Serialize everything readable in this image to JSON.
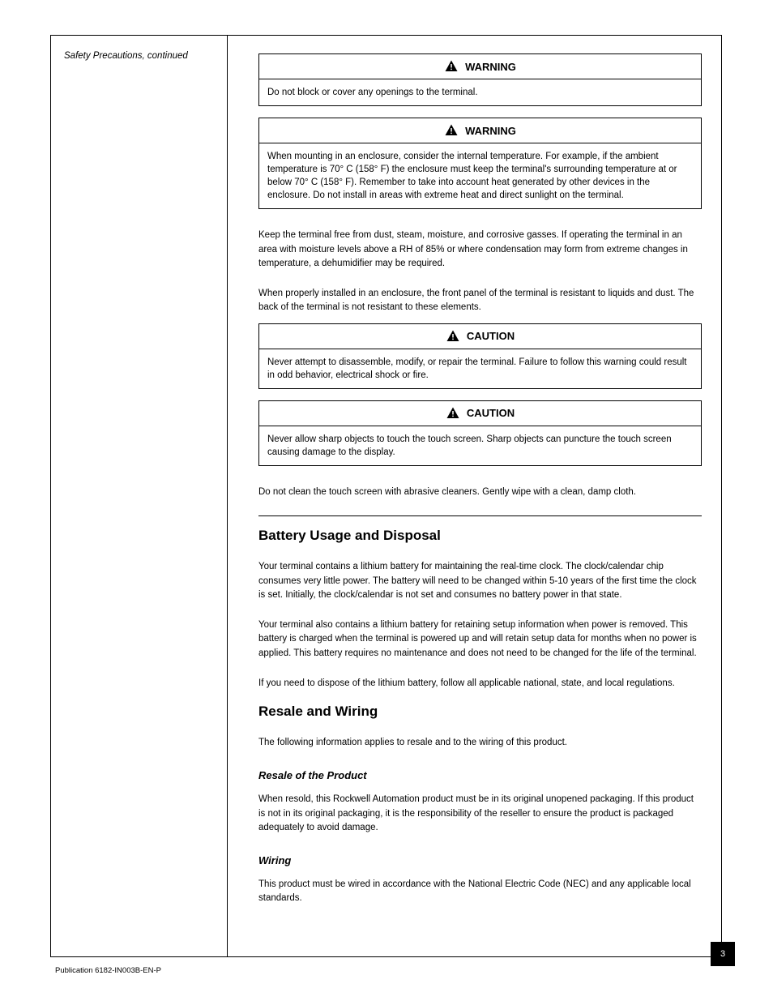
{
  "sidebar": {
    "kicker": "Safety Precautions, continued"
  },
  "callouts": [
    {
      "label": "WARNING",
      "body": "Do not block or cover any openings to the terminal."
    },
    {
      "label": "WARNING",
      "body": "When mounting in an enclosure, consider the internal temperature. For example, if the ambient temperature is 70° C (158° F) the enclosure must keep the terminal's surrounding temperature at or below 70° C  (158° F). Remember to take into account heat generated by other devices in the enclosure. Do not install in areas with extreme heat and direct sunlight on the terminal."
    },
    {
      "label": "CAUTION",
      "body": "Never attempt to disassemble, modify, or repair the terminal. Failure to follow this warning could result in odd behavior, electrical shock or fire."
    },
    {
      "label": "CAUTION",
      "body": "Never allow sharp objects to touch the touch screen. Sharp objects can puncture the touch screen causing damage to the display."
    }
  ],
  "paras": {
    "p1": "Keep the terminal free from dust, steam, moisture, and corrosive gasses. If operating the terminal in an area with moisture levels above a RH of 85% or where condensation may form from extreme changes in temperature, a dehumidifier may be required.",
    "p2": "When properly installed in an enclosure, the front panel of the terminal is resistant to liquids and dust. The back of the terminal is not resistant to these elements.",
    "p3": "Do not clean the touch screen with abrasive cleaners.  Gently wipe with a clean, damp cloth.",
    "p4": "Your terminal contains a lithium battery for maintaining the real-time clock. The clock/calendar chip consumes very little power. The battery will need to be changed within 5-10 years of the first time the clock is set. Initially, the clock/calendar is not set and consumes no battery power in that state.",
    "p5": "Your terminal also contains a lithium battery for retaining setup information when power is removed. This battery is charged when the terminal is powered up and will retain setup data for months when no power is applied. This battery requires no maintenance and does not need to be changed for the life of the terminal.",
    "p6": "If you need to dispose of the lithium battery, follow all applicable national, state, and local regulations.",
    "p7": "The following information applies to resale and to the wiring of this product.",
    "p8": "When resold, this Rockwell Automation product must be in its original unopened packaging. If this product is not in its original packaging, it is the responsibility of the reseller to ensure the product is packaged adequately to avoid damage.",
    "p9": "This product must be wired in accordance with the National Electric Code (NEC) and any applicable local standards."
  },
  "headings": {
    "battery": "Battery Usage and Disposal",
    "resale": "Resale and Wiring",
    "resale_sub": "Resale of the Product",
    "wiring_sub": "Wiring"
  },
  "footer": {
    "pub": "Publication 6182-IN003B-EN-P"
  },
  "page_number": "3"
}
